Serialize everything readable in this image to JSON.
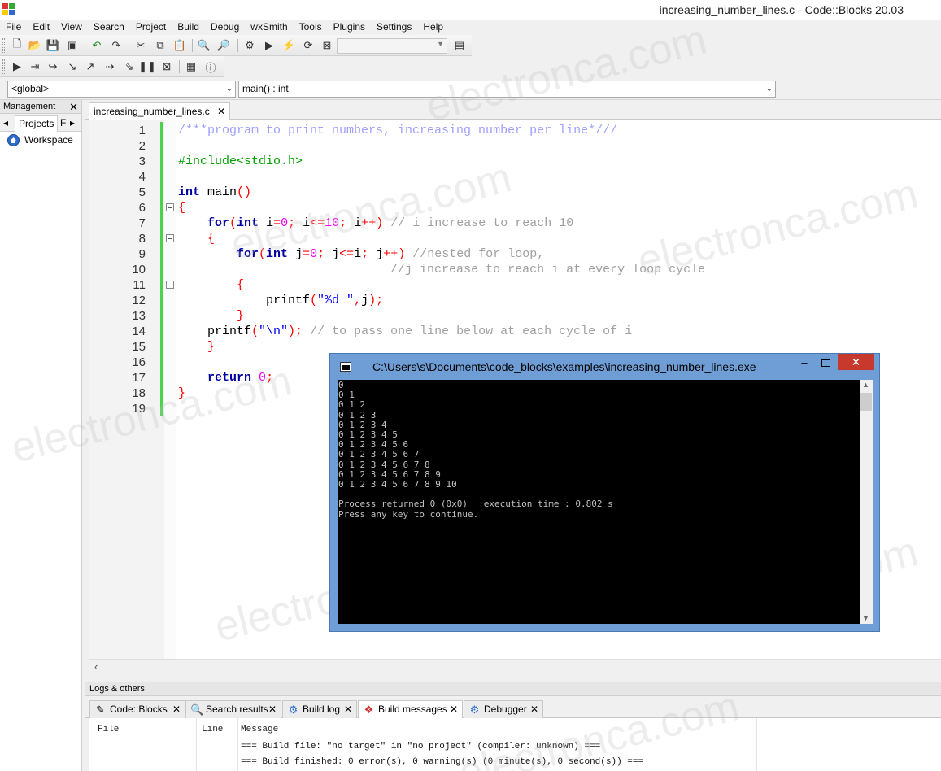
{
  "window": {
    "title": "increasing_number_lines.c - Code::Blocks 20.03"
  },
  "menu": [
    "File",
    "Edit",
    "View",
    "Search",
    "Project",
    "Build",
    "Debug",
    "wxSmith",
    "Tools",
    "Plugins",
    "Settings",
    "Help"
  ],
  "scope": {
    "global": "<global>",
    "function": "main() : int"
  },
  "management": {
    "title": "Management",
    "tabs": [
      "Projects",
      "F"
    ],
    "workspace": "Workspace"
  },
  "editor": {
    "tab": "increasing_number_lines.c",
    "lines": [
      {
        "n": "1",
        "parts": [
          [
            "c-com",
            "/***program to print numbers, increasing number per line*///"
          ]
        ]
      },
      {
        "n": "2",
        "parts": []
      },
      {
        "n": "3",
        "parts": [
          [
            "c-pre",
            "#include<stdio.h>"
          ]
        ]
      },
      {
        "n": "4",
        "parts": []
      },
      {
        "n": "5",
        "parts": [
          [
            "c-key",
            "int"
          ],
          [
            "c-plain",
            " main"
          ],
          [
            "c-op",
            "()"
          ]
        ]
      },
      {
        "n": "6",
        "fold": true,
        "parts": [
          [
            "c-brace",
            "{"
          ]
        ]
      },
      {
        "n": "7",
        "parts": [
          [
            "c-plain",
            "    "
          ],
          [
            "c-key",
            "for"
          ],
          [
            "c-op",
            "("
          ],
          [
            "c-key",
            "int"
          ],
          [
            "c-plain",
            " i"
          ],
          [
            "c-op",
            "="
          ],
          [
            "c-num",
            "0"
          ],
          [
            "c-op",
            ";"
          ],
          [
            "c-plain",
            " i"
          ],
          [
            "c-op",
            "<="
          ],
          [
            "c-num",
            "10"
          ],
          [
            "c-op",
            ";"
          ],
          [
            "c-plain",
            " i"
          ],
          [
            "c-op",
            "++)"
          ],
          [
            "c-plain",
            " "
          ],
          [
            "c-comg",
            "// i increase to reach 10"
          ]
        ]
      },
      {
        "n": "8",
        "fold": true,
        "parts": [
          [
            "c-plain",
            "    "
          ],
          [
            "c-brace",
            "{"
          ]
        ]
      },
      {
        "n": "9",
        "parts": [
          [
            "c-plain",
            "        "
          ],
          [
            "c-key",
            "for"
          ],
          [
            "c-op",
            "("
          ],
          [
            "c-key",
            "int"
          ],
          [
            "c-plain",
            " j"
          ],
          [
            "c-op",
            "="
          ],
          [
            "c-num",
            "0"
          ],
          [
            "c-op",
            ";"
          ],
          [
            "c-plain",
            " j"
          ],
          [
            "c-op",
            "<="
          ],
          [
            "c-plain",
            "i"
          ],
          [
            "c-op",
            ";"
          ],
          [
            "c-plain",
            " j"
          ],
          [
            "c-op",
            "++)"
          ],
          [
            "c-plain",
            " "
          ],
          [
            "c-comg",
            "//nested for loop,"
          ]
        ]
      },
      {
        "n": "10",
        "parts": [
          [
            "c-plain",
            "                             "
          ],
          [
            "c-comg",
            "//j increase to reach i at every loop cycle"
          ]
        ]
      },
      {
        "n": "11",
        "fold": true,
        "parts": [
          [
            "c-plain",
            "        "
          ],
          [
            "c-brace",
            "{"
          ]
        ]
      },
      {
        "n": "12",
        "parts": [
          [
            "c-plain",
            "            printf"
          ],
          [
            "c-op",
            "("
          ],
          [
            "c-str",
            "\"%d \""
          ],
          [
            "c-op",
            ","
          ],
          [
            "c-plain",
            "j"
          ],
          [
            "c-op",
            ");"
          ]
        ]
      },
      {
        "n": "13",
        "parts": [
          [
            "c-plain",
            "        "
          ],
          [
            "c-brace",
            "}"
          ]
        ]
      },
      {
        "n": "14",
        "parts": [
          [
            "c-plain",
            "    printf"
          ],
          [
            "c-op",
            "("
          ],
          [
            "c-str",
            "\"\\n\""
          ],
          [
            "c-op",
            ");"
          ],
          [
            "c-plain",
            " "
          ],
          [
            "c-comg",
            "// to pass one line below at each cycle of i"
          ]
        ]
      },
      {
        "n": "15",
        "parts": [
          [
            "c-plain",
            "    "
          ],
          [
            "c-brace",
            "}"
          ]
        ]
      },
      {
        "n": "16",
        "parts": []
      },
      {
        "n": "17",
        "parts": [
          [
            "c-plain",
            "    "
          ],
          [
            "c-key",
            "return"
          ],
          [
            "c-plain",
            " "
          ],
          [
            "c-num",
            "0"
          ],
          [
            "c-op",
            ";"
          ]
        ]
      },
      {
        "n": "18",
        "parts": [
          [
            "c-brace",
            "}"
          ]
        ]
      },
      {
        "n": "19",
        "parts": []
      }
    ]
  },
  "console": {
    "title": "C:\\Users\\s\\Documents\\code_blocks\\examples\\increasing_number_lines.exe",
    "close": "✕",
    "minimize": "–",
    "output": "0\n0 1\n0 1 2\n0 1 2 3\n0 1 2 3 4\n0 1 2 3 4 5\n0 1 2 3 4 5 6\n0 1 2 3 4 5 6 7\n0 1 2 3 4 5 6 7 8\n0 1 2 3 4 5 6 7 8 9\n0 1 2 3 4 5 6 7 8 9 10\n\nProcess returned 0 (0x0)   execution time : 0.802 s\nPress any key to continue."
  },
  "logs": {
    "title": "Logs & others",
    "tabs": [
      "Code::Blocks",
      "Search results",
      "Build log",
      "Build messages",
      "Debugger"
    ],
    "active_tab": "Build messages",
    "columns": [
      "File",
      "Line",
      "Message"
    ],
    "messages": [
      "=== Build file: \"no target\" in \"no project\" (compiler: unknown) ===",
      "=== Build finished: 0 error(s), 0 warning(s) (0 minute(s), 0 second(s)) ==="
    ]
  },
  "watermark": "electronca.com",
  "colors": {
    "change_bar": "#4bd24b",
    "console_frame": "#6f9ed6",
    "close_button": "#c7392c"
  }
}
